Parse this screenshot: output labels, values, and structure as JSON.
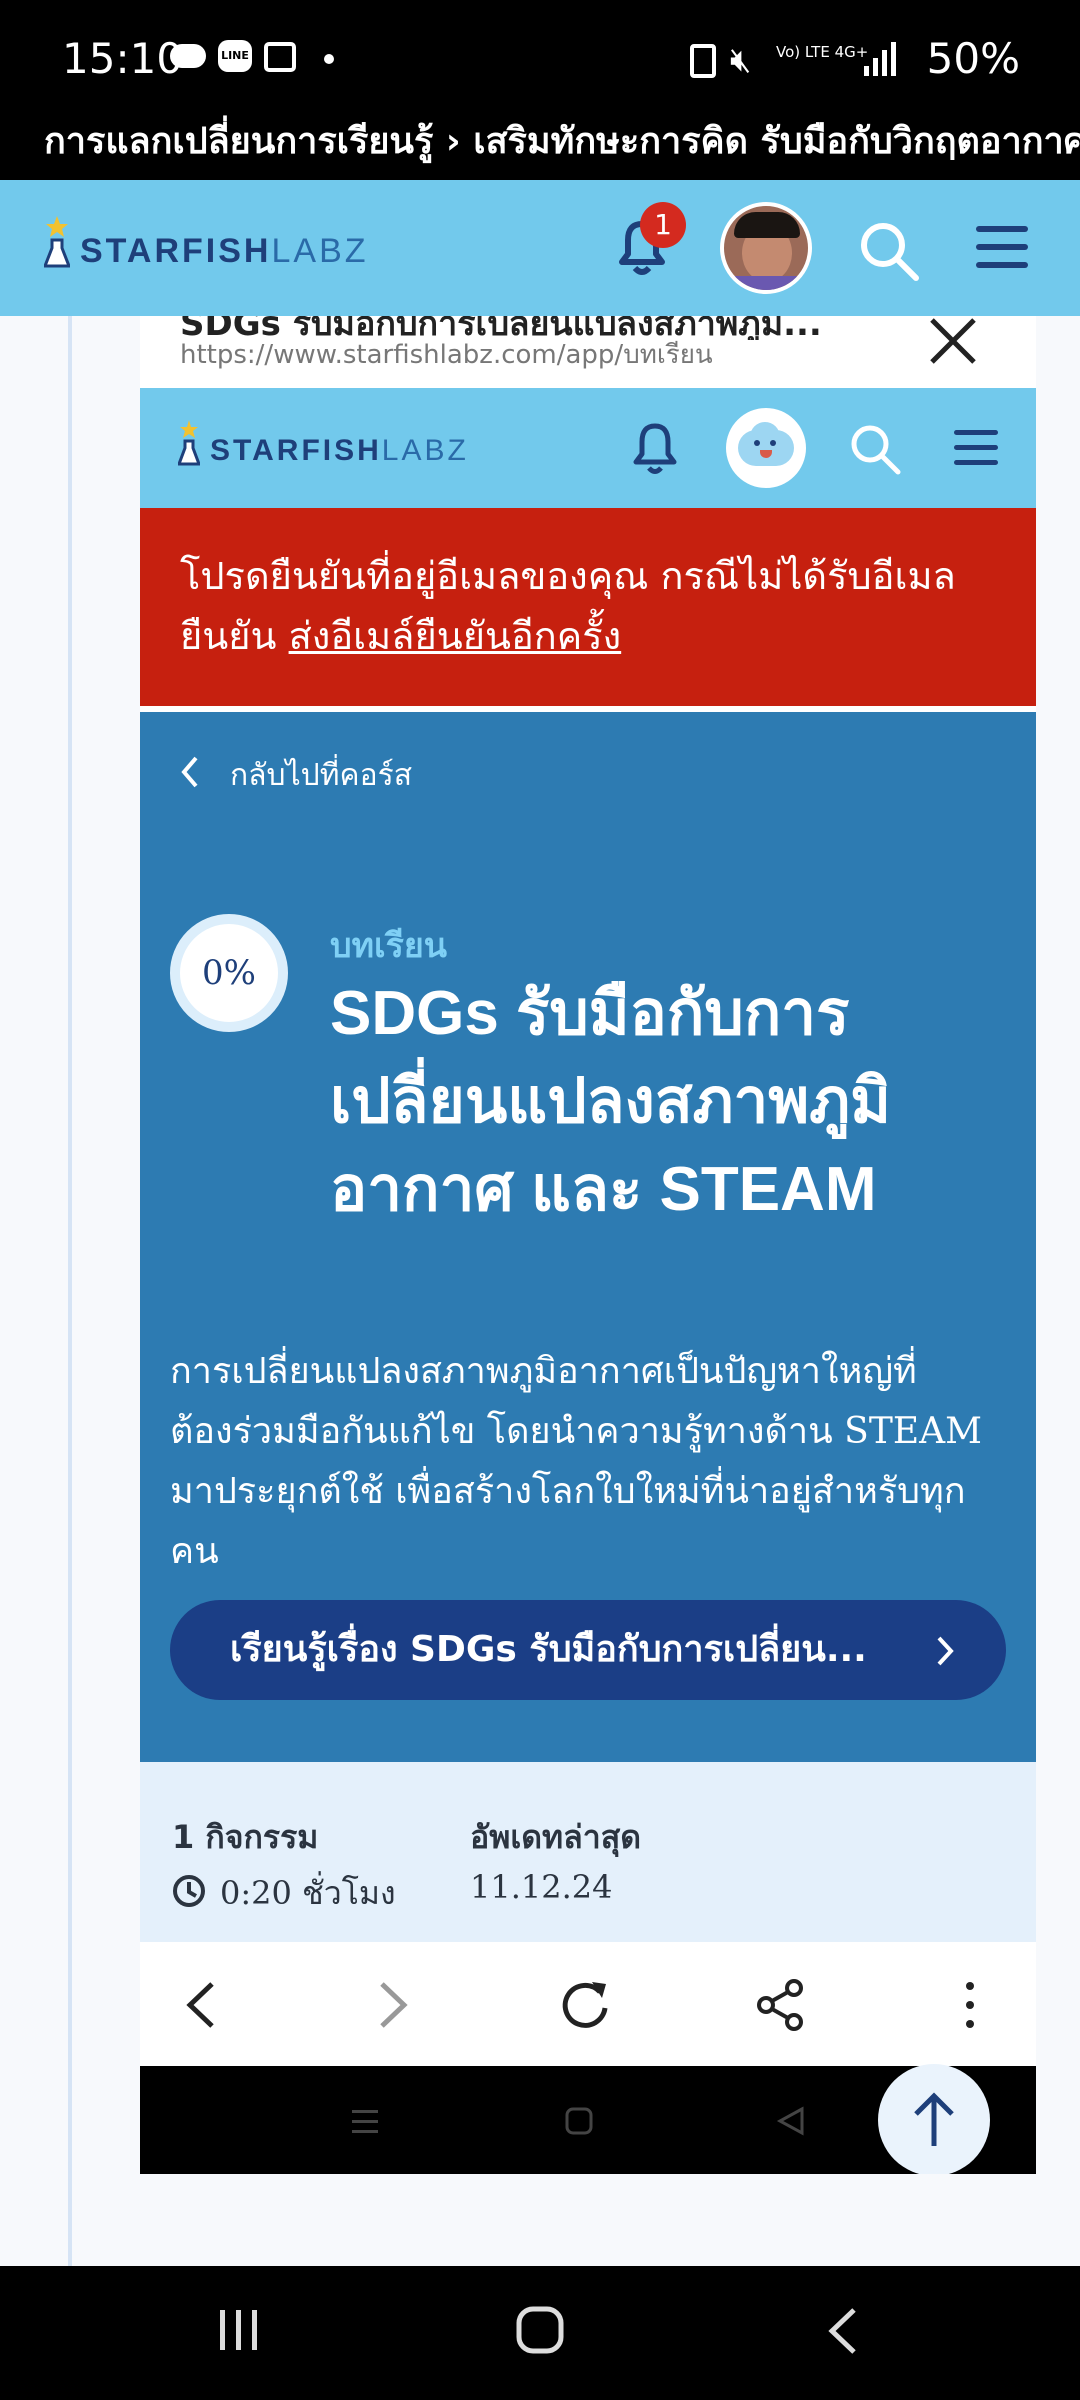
{
  "status_bar": {
    "time": "15:10",
    "network": "Vo) LTE 4G+",
    "battery": "50%"
  },
  "app_title": "การแลกเปลี่ยนการเรียนรู้ › เสริมทักษะการคิด รับมือกับวิกฤตอากาศ...",
  "outer_nav": {
    "logo_bold": "STARFISH",
    "logo_light": "LABZ",
    "notification_count": "1"
  },
  "popup": {
    "truncated_title": "SDGs รับมือกับการเปลี่ยนแปลงสภาพภูมิ...",
    "url": "https://www.starfishlabz.com/app/บทเรียน"
  },
  "inner_nav": {
    "logo_bold": "STARFISH",
    "logo_light": "LABZ"
  },
  "alert": {
    "text": "โปรดยืนยันที่อยู่อีเมลของคุณ กรณีไม่ได้รับอีเมลยืนยัน ",
    "link": "ส่งอีเมล์ยืนยันอีกครั้ง"
  },
  "hero": {
    "back_label": "กลับไปที่คอร์ส",
    "progress": "0%",
    "kicker": "บทเรียน",
    "title_lines": [
      "SDGs รับมือกับการ",
      "เปลี่ยนแปลงสภาพภูมิ",
      "อากาศ และ STEAM"
    ],
    "desc_lines": [
      "การเปลี่ยนแปลงสภาพภูมิอากาศเป็นปัญหาใหญ่ที่",
      "ต้องร่วมมือกันแก้ไข โดยนำความรู้ทางด้าน STEAM",
      "มาประยุกต์ใช้ เพื่อสร้างโลกใบใหม่ที่น่าอยู่สำหรับทุก",
      "คน"
    ],
    "cta": "เรียนรู้เรื่อง SDGs รับมือกับการเปลี่ยน..."
  },
  "stats": {
    "activities": "1 กิจกรรม",
    "duration": "0:20 ชั่วโมง",
    "updated_label": "อัพเดทล่าสุด",
    "updated_value": "11.12.24"
  },
  "colors": {
    "nav": "#72c9ec",
    "alert": "#c6200f",
    "hero": "#2d7bb2",
    "button": "#1b3e86",
    "kicker": "#7fd0f5"
  }
}
